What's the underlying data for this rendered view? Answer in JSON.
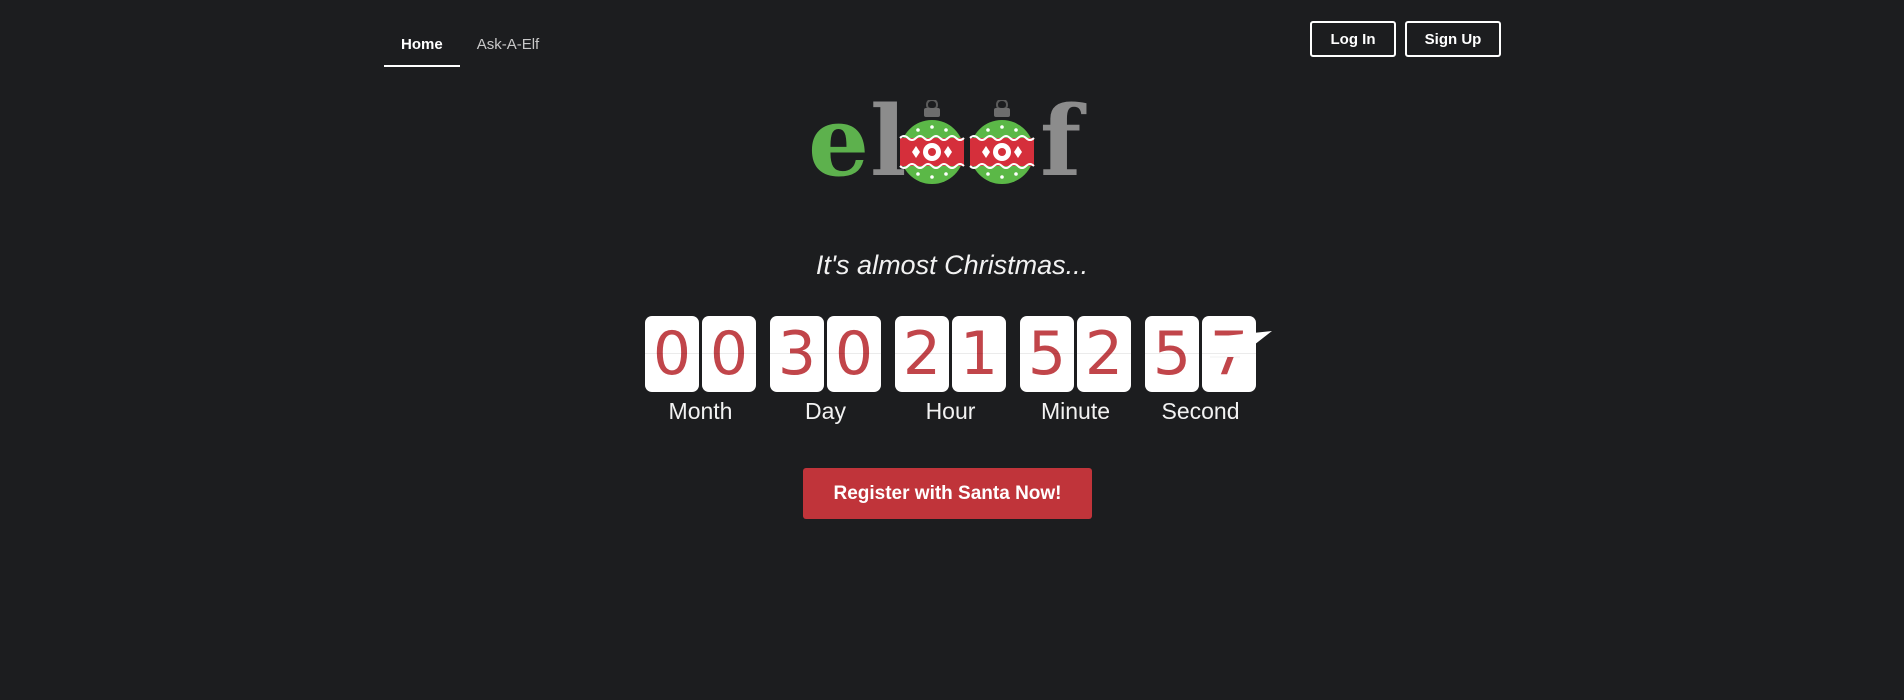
{
  "nav": {
    "tabs": [
      {
        "label": "Home",
        "active": true
      },
      {
        "label": "Ask-A-Elf",
        "active": false
      }
    ]
  },
  "auth": {
    "login_label": "Log In",
    "signup_label": "Sign Up"
  },
  "logo": {
    "text": "eloof",
    "icon": "christmas-ornament-icon",
    "colors": {
      "e": "#5db14d",
      "rest": "#8c8c8c",
      "ornament_red": "#d52f3b",
      "ornament_green": "#5bb847"
    }
  },
  "tagline": "It's almost Christmas...",
  "countdown": {
    "units": [
      {
        "label": "Month",
        "digits": [
          "0",
          "0"
        ]
      },
      {
        "label": "Day",
        "digits": [
          "3",
          "0"
        ]
      },
      {
        "label": "Hour",
        "digits": [
          "2",
          "1"
        ]
      },
      {
        "label": "Minute",
        "digits": [
          "5",
          "2"
        ]
      },
      {
        "label": "Second",
        "digits": [
          "5",
          "7"
        ]
      }
    ],
    "digit_color": "#c1454a"
  },
  "cta": {
    "label": "Register with Santa Now!",
    "color": "#c0343a"
  },
  "colors": {
    "background": "#1c1d1f"
  }
}
